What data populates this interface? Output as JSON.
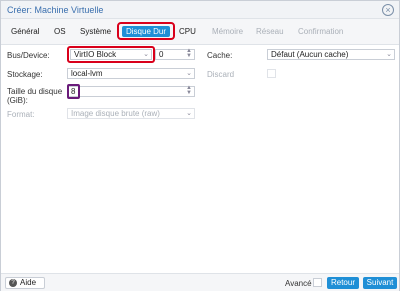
{
  "window": {
    "title": "Créer: Machine Virtuelle",
    "close_icon": "close-circle-icon"
  },
  "tabs": [
    {
      "label": "Général",
      "state": "normal"
    },
    {
      "label": "OS",
      "state": "normal"
    },
    {
      "label": "Système",
      "state": "normal"
    },
    {
      "label": "Disque Dur",
      "state": "active"
    },
    {
      "label": "CPU",
      "state": "normal"
    },
    {
      "label": "Mémoire",
      "state": "disabled"
    },
    {
      "label": "Réseau",
      "state": "disabled"
    },
    {
      "label": "Confirmation",
      "state": "disabled"
    }
  ],
  "form": {
    "bus_device": {
      "label": "Bus/Device:",
      "bus_value": "VirtIO Block",
      "device_value": "0"
    },
    "storage": {
      "label": "Stockage:",
      "value": "local-lvm"
    },
    "disk_size": {
      "label_line1": "Taille du disque",
      "label_line2": "(GiB):",
      "value": "8"
    },
    "format": {
      "label": "Format:",
      "value": "Image disque brute (raw)"
    },
    "cache": {
      "label": "Cache:",
      "value": "Défaut (Aucun cache)"
    },
    "discard": {
      "label": "Discard"
    }
  },
  "footer": {
    "help_label": "Aide",
    "advanced_label": "Avancé",
    "back_label": "Retour",
    "next_label": "Suivant"
  },
  "colors": {
    "accent": "#1f8fd6",
    "highlight_red": "#d9001b",
    "highlight_purple": "#6a1b7a"
  }
}
